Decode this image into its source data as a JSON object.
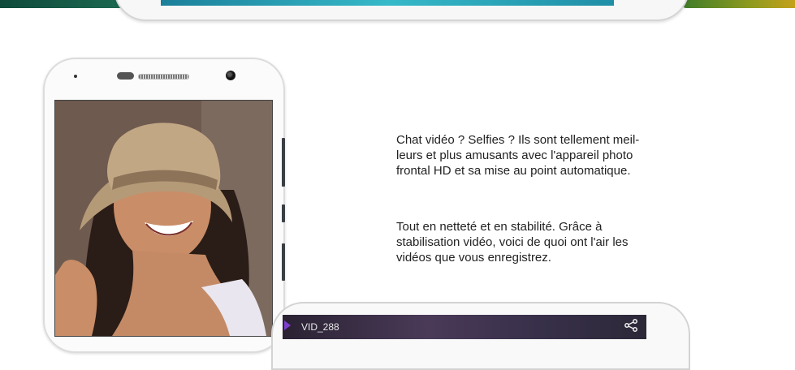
{
  "content": {
    "paragraph_1": "Chat vidéo ? Selfies ? Ils sont tellement meil-leurs et plus amusants avec l'appareil photo frontal HD et sa mise au point automatique.",
    "paragraph_1_lines": [
      "Chat vidéo ? Selfies ? Ils sont tellement meil-",
      "leurs et plus amusants avec l'appareil photo",
      "frontal HD et sa mise au point automatique."
    ],
    "paragraph_2_lines": [
      "Tout en netteté et en stabilité. Grâce à",
      "stabilisation vidéo, voici de quoi ont l'air les",
      "vidéos que vous enregistrez."
    ]
  },
  "video_player": {
    "file_label": "VID_288",
    "icons": [
      "video-icon",
      "share-icon"
    ]
  },
  "colors": {
    "text": "#222222",
    "accent_video": "#7d3fd0"
  }
}
